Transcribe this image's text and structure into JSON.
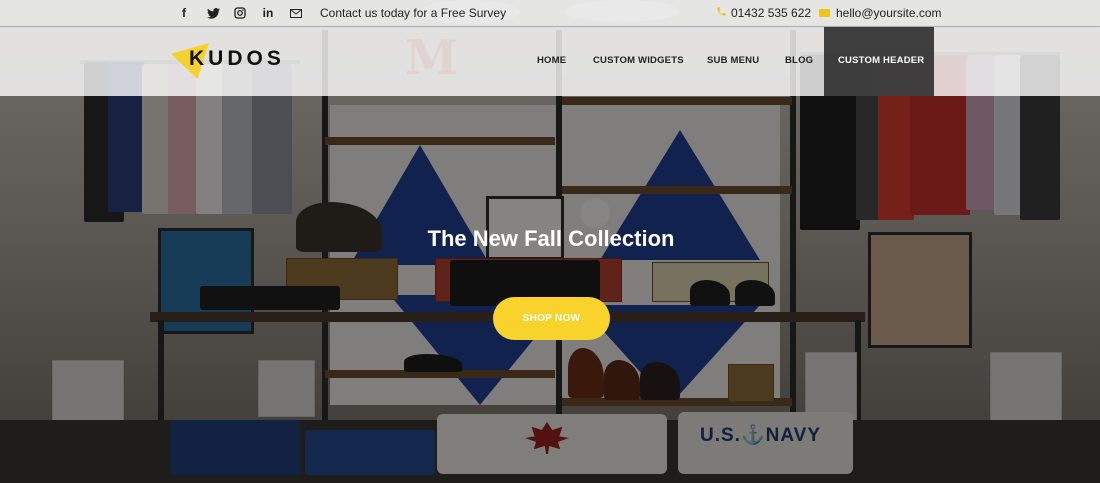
{
  "topbar": {
    "social": [
      {
        "icon": "facebook-icon",
        "glyph": "f"
      },
      {
        "icon": "twitter-icon",
        "glyph": ""
      },
      {
        "icon": "instagram-icon",
        "glyph": ""
      },
      {
        "icon": "linkedin-icon",
        "glyph": "in"
      },
      {
        "icon": "mail-icon",
        "glyph": ""
      }
    ],
    "contact_text": "Contact us today for a Free Survey",
    "phone": "01432 535 622",
    "email": "hello@yoursite.com"
  },
  "header": {
    "logo_text": "KUDOS",
    "nav": [
      {
        "label": "HOME"
      },
      {
        "label": "CUSTOM WIDGETS"
      },
      {
        "label": "SUB MENU"
      },
      {
        "label": "BLOG"
      },
      {
        "label": "CUSTOM HEADER"
      }
    ]
  },
  "hero": {
    "title": "The New Fall Collection",
    "button_label": "SHOP NOW",
    "decor_letter": "M",
    "shirt_text": "U.S.⚓NAVY"
  },
  "colors": {
    "accent": "#f7d32b",
    "topbar_bg": "#ffffff",
    "active_nav_bg": "#282828"
  }
}
